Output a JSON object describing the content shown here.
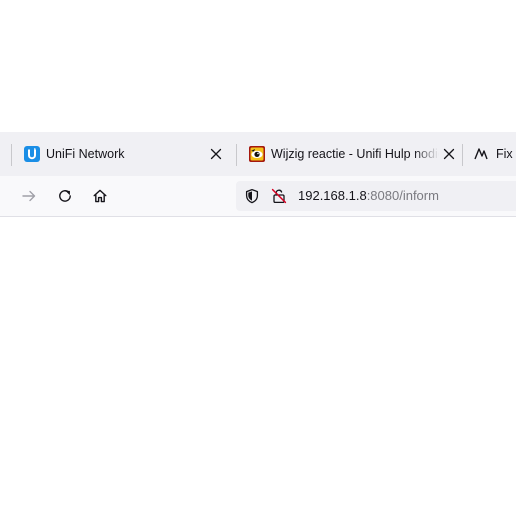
{
  "tabs": [
    {
      "title": "UniFi Network",
      "favicon": "unifi-logo-icon",
      "close": "close-icon"
    },
    {
      "title": "Wijzig reactie - Unifi Hulp nodig",
      "favicon": "eye-logo-icon",
      "close": "close-icon"
    },
    {
      "title": "Fix U",
      "favicon": "wave-logo-icon"
    }
  ],
  "toolbar": {
    "forward_icon": "arrow-right-icon",
    "reload_icon": "reload-icon",
    "home_icon": "home-icon"
  },
  "urlbar": {
    "shield_icon": "shield-icon",
    "lock_icon": "insecure-lock-icon",
    "host": "192.168.1.8",
    "rest": ":8080/inform"
  },
  "colors": {
    "tabstrip_bg": "#f0f0f4",
    "toolbar_bg": "#f9f9fb",
    "unifi_blue": "#1a8ee6",
    "insecure_red": "#d70022"
  }
}
